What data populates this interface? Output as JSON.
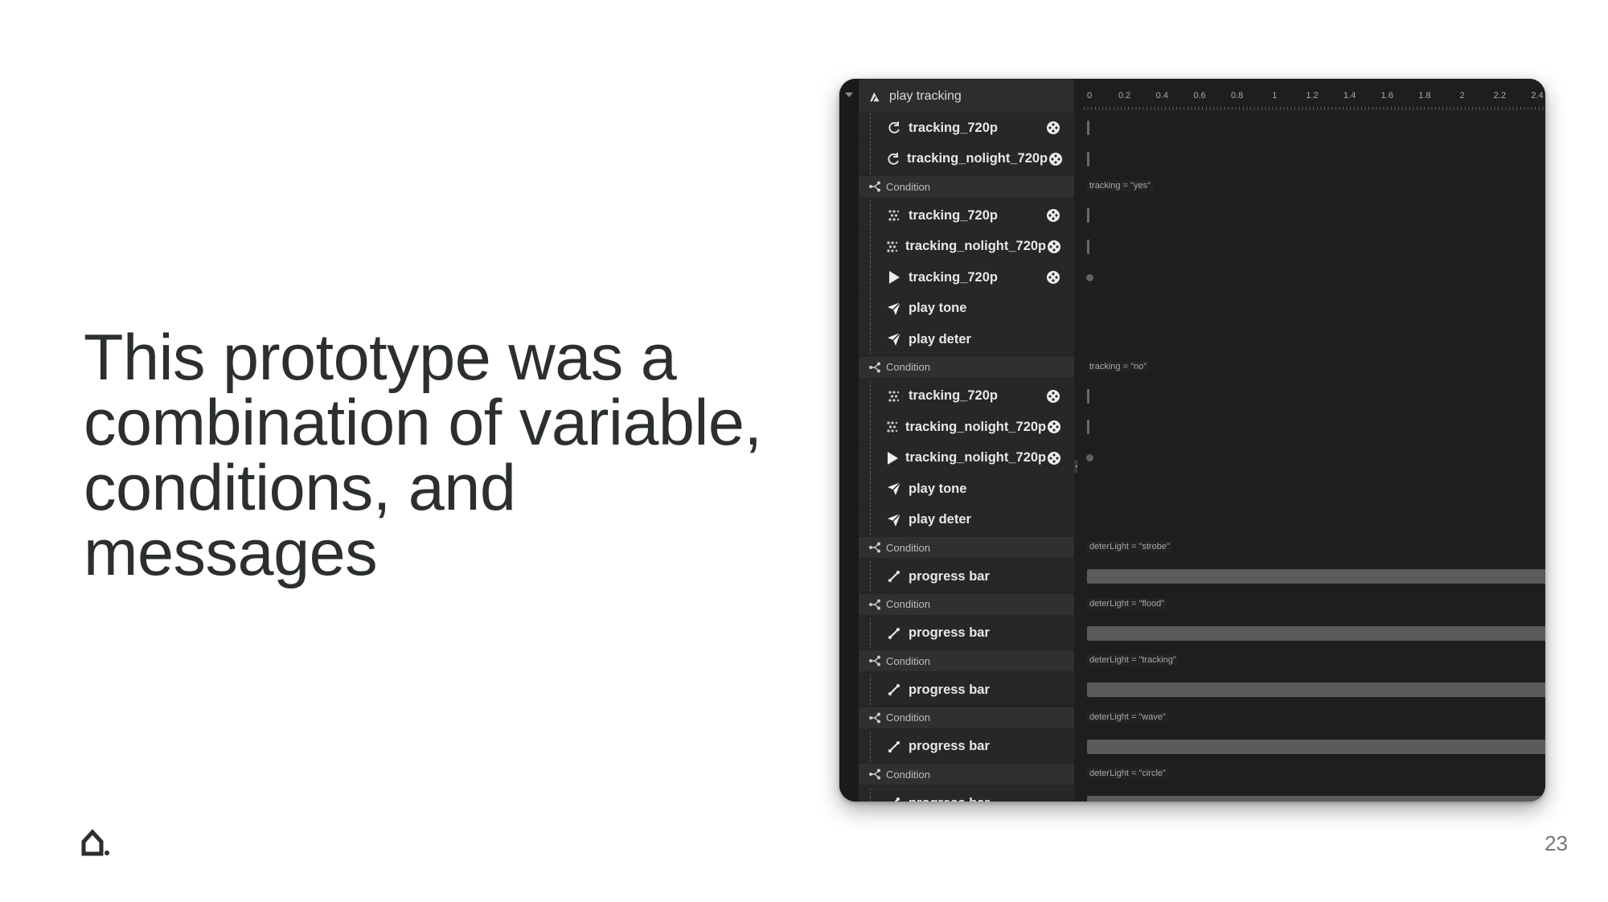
{
  "slide": {
    "headline": "This prototype was a combination of variable, conditions, and messages",
    "page_number": "23",
    "logo_icon": "house-dot-icon"
  },
  "editor": {
    "root": {
      "label": "play tracking",
      "icon": "play-tracking-icon"
    },
    "rows": [
      {
        "kind": "item",
        "label": "tracking_720p",
        "icon": "loop-icon",
        "eye": true
      },
      {
        "kind": "item",
        "label": "tracking_nolight_720p",
        "icon": "loop-icon",
        "eye": true
      },
      {
        "kind": "cond",
        "label": "Condition",
        "icon": "branch-icon",
        "expression": "tracking = \"yes\""
      },
      {
        "kind": "item",
        "label": "tracking_720p",
        "icon": "dotted-grid-icon",
        "eye": true
      },
      {
        "kind": "item",
        "label": "tracking_nolight_720p",
        "icon": "dotted-grid-icon",
        "eye": true
      },
      {
        "kind": "item",
        "label": "tracking_720p",
        "icon": "play-icon",
        "eye": true
      },
      {
        "kind": "item",
        "label": "play tone",
        "icon": "send-icon",
        "eye": false
      },
      {
        "kind": "item",
        "label": "play deter",
        "icon": "send-icon",
        "eye": false
      },
      {
        "kind": "cond",
        "label": "Condition",
        "icon": "branch-icon",
        "expression": "tracking = \"no\""
      },
      {
        "kind": "item",
        "label": "tracking_720p",
        "icon": "dotted-grid-icon",
        "eye": true
      },
      {
        "kind": "item",
        "label": "tracking_nolight_720p",
        "icon": "dotted-grid-icon",
        "eye": true
      },
      {
        "kind": "item",
        "label": "tracking_nolight_720p",
        "icon": "play-icon",
        "eye": true
      },
      {
        "kind": "item",
        "label": "play tone",
        "icon": "send-icon",
        "eye": false
      },
      {
        "kind": "item",
        "label": "play deter",
        "icon": "send-icon",
        "eye": false
      },
      {
        "kind": "cond",
        "label": "Condition",
        "icon": "branch-icon",
        "expression": "deterLight = \"strobe\""
      },
      {
        "kind": "item",
        "label": "progress bar",
        "icon": "resize-icon",
        "eye": false
      },
      {
        "kind": "cond",
        "label": "Condition",
        "icon": "branch-icon",
        "expression": "deterLight = \"flood\""
      },
      {
        "kind": "item",
        "label": "progress bar",
        "icon": "resize-icon",
        "eye": false
      },
      {
        "kind": "cond",
        "label": "Condition",
        "icon": "branch-icon",
        "expression": "deterLight = \"tracking\""
      },
      {
        "kind": "item",
        "label": "progress bar",
        "icon": "resize-icon",
        "eye": false
      },
      {
        "kind": "cond",
        "label": "Condition",
        "icon": "branch-icon",
        "expression": "deterLight = \"wave\""
      },
      {
        "kind": "item",
        "label": "progress bar",
        "icon": "resize-icon",
        "eye": false
      },
      {
        "kind": "cond",
        "label": "Condition",
        "icon": "branch-icon",
        "expression": "deterLight = \"circle\""
      },
      {
        "kind": "item",
        "label": "progress bar",
        "icon": "resize-icon",
        "eye": false
      }
    ],
    "add_label": "+",
    "ruler_ticks": [
      "0",
      "0.2",
      "0.4",
      "0.6",
      "0.8",
      "1",
      "1.2",
      "1.4",
      "1.6",
      "1.8",
      "2",
      "2.2",
      "2.4"
    ],
    "timeline_marks": [
      {
        "row": 0,
        "type": "line"
      },
      {
        "row": 1,
        "type": "line"
      },
      {
        "row": 3,
        "type": "line"
      },
      {
        "row": 4,
        "type": "line"
      },
      {
        "row": 5,
        "type": "dot"
      },
      {
        "row": 9,
        "type": "line"
      },
      {
        "row": 10,
        "type": "line"
      },
      {
        "row": 11,
        "type": "dot"
      },
      {
        "row": 15,
        "type": "bar"
      },
      {
        "row": 17,
        "type": "bar"
      },
      {
        "row": 19,
        "type": "bar"
      },
      {
        "row": 21,
        "type": "bar"
      },
      {
        "row": 23,
        "type": "bar"
      }
    ],
    "colors": {
      "panel_bg": "#1e1e1e",
      "tree_bg": "#262626",
      "condition_bg": "#303030",
      "bar": "#5b5b5b"
    }
  }
}
